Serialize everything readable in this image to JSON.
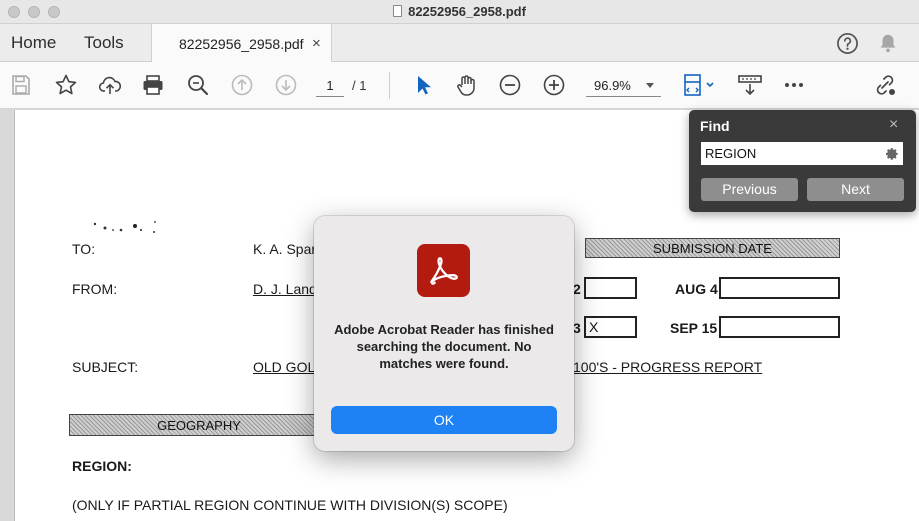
{
  "window": {
    "title": "82252956_2958.pdf"
  },
  "tabbar": {
    "home_label": "Home",
    "tools_label": "Tools",
    "doc_tab_label": "82252956_2958.pdf",
    "doc_tab_close": "×",
    "icons": [
      "help-icon",
      "notification-bell-icon"
    ]
  },
  "toolbar": {
    "icons": [
      "save-icon",
      "bookmark-star-icon",
      "upload-cloud-icon",
      "print-icon",
      "zoom-search-icon",
      "previous-page-icon",
      "next-page-icon",
      "select-cursor-icon",
      "hand-tool-icon",
      "zoom-out-icon",
      "zoom-in-icon",
      "scroll-mode-icon",
      "read-mode-icon",
      "more-icon",
      "share-link-icon"
    ],
    "current_page": "1",
    "page_total": "/ 1",
    "zoom": "96.9%"
  },
  "document": {
    "to_label": "TO:",
    "to_value": "K. A. Spar",
    "from_label": "FROM:",
    "from_value": "D. J. Land",
    "submission_header": "SUBMISSION DATE",
    "row1_number": "2",
    "row1_date": "AUG 4",
    "row2_number": "3",
    "row2_mark": "X",
    "row2_date": "SEP 15",
    "subject_label": "SUBJECT:",
    "subject_left": "OLD GOL",
    "subject_right": "100'S - PROGRESS REPORT",
    "geography_header": "GEOGRAPHY",
    "region_label": "REGION:",
    "partial_note": "(ONLY IF PARTIAL REGION CONTINUE WITH DIVISION(S) SCOPE)"
  },
  "find_panel": {
    "title": "Find",
    "close": "×",
    "query": "REGION",
    "previous_label": "Previous",
    "next_label": "Next"
  },
  "dialog": {
    "message": "Adobe Acrobat Reader has finished searching the document. No matches were found.",
    "ok_label": "OK"
  },
  "colors": {
    "dialog_button": "#1e82f5",
    "acrobat_red": "#b41b10",
    "find_panel_bg": "#3a3a3a",
    "select_tool_active": "#1565c0"
  }
}
